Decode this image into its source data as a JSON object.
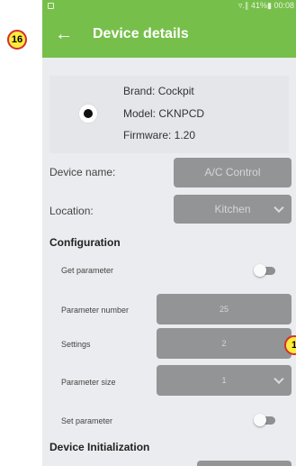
{
  "markers": {
    "left": "16",
    "right": "1"
  },
  "status_bar": {
    "right_text": "▿.∥ 41%▮ 00:08"
  },
  "app_bar": {
    "back_icon": "arrow-left-icon",
    "title": "Device details"
  },
  "device": {
    "brand": "Brand: Cockpit",
    "model": "Model: CKNPCD",
    "firmware": "Firmware: 1.20"
  },
  "fields": {
    "device_name_label": "Device name:",
    "device_name_value": "A/C Control",
    "location_label": "Location:",
    "location_value": "Kitchen"
  },
  "configuration": {
    "title": "Configuration",
    "get_parameter_label": "Get parameter",
    "parameter_number_label": "Parameter number",
    "parameter_number_value": "25",
    "settings_label": "Settings",
    "settings_value": "2",
    "parameter_size_label": "Parameter size",
    "parameter_size_value": "1",
    "set_parameter_label": "Set parameter"
  },
  "device_initialization": {
    "title": "Device Initialization"
  },
  "colors": {
    "accent": "#77bf4b",
    "field": "#939496",
    "background": "#ebecef"
  }
}
